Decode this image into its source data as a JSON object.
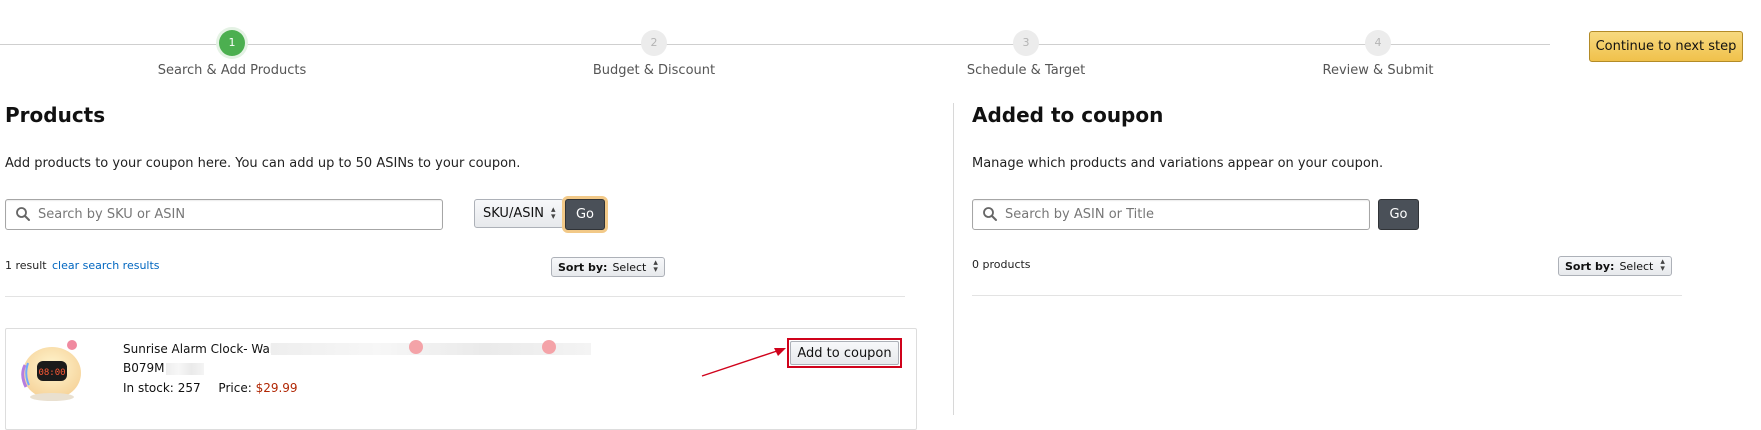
{
  "stepper": {
    "steps": [
      {
        "number": "1",
        "label": "Search & Add Products",
        "state": "active"
      },
      {
        "number": "2",
        "label": "Budget & Discount",
        "state": "pending"
      },
      {
        "number": "3",
        "label": "Schedule & Target",
        "state": "pending"
      },
      {
        "number": "4",
        "label": "Review & Submit",
        "state": "pending"
      }
    ],
    "continue_label": "Continue to next step"
  },
  "products_panel": {
    "title": "Products",
    "description": "Add products to your coupon here. You can add up to 50 ASINs to your coupon.",
    "search_placeholder": "Search by SKU or ASIN",
    "search_type": "SKU/ASIN",
    "go_label": "Go",
    "result_count": "1 result",
    "clear_label": "clear search results",
    "sort_label": "Sort by:",
    "sort_value": "Select",
    "results": [
      {
        "name": "Sunrise Alarm Clock- Wak",
        "asin": "B079M",
        "stock_label": "In stock:",
        "stock": "257",
        "price_label": "Price:",
        "price": "$29.99",
        "add_label": "Add to coupon"
      }
    ]
  },
  "coupon_panel": {
    "title": "Added to coupon",
    "description": "Manage which products and variations appear on your coupon.",
    "search_placeholder": "Search by ASIN or Title",
    "go_label": "Go",
    "count": "0 products",
    "sort_label": "Sort by:",
    "sort_value": "Select"
  },
  "colors": {
    "active_step": "#4caf50",
    "primary_button": "#f0c14b",
    "go_button": "#4a5058",
    "link": "#0066c0",
    "price": "#b12704",
    "annotation": "#d0021b"
  },
  "icons": {
    "search": "search-icon",
    "sort_arrows": "up-down-arrows-icon"
  }
}
